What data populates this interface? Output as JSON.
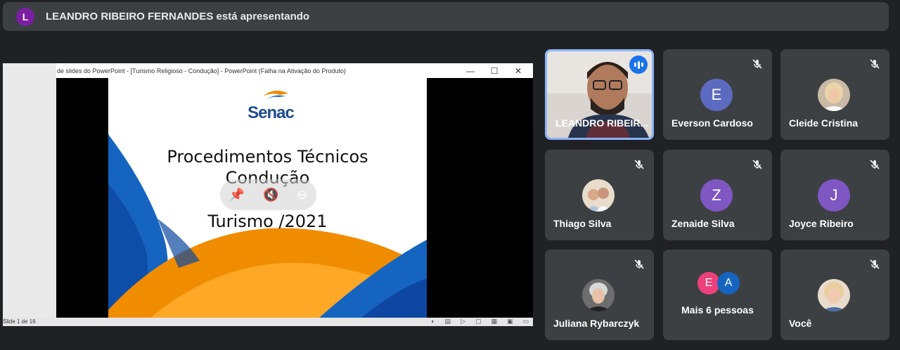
{
  "banner": {
    "avatar_letter": "L",
    "text": "LEANDRO RIBEIRO FERNANDES está apresentando",
    "avatar_color": "#7b1fa2"
  },
  "presentation": {
    "window_title": "de slides do PowerPoint - [Turismo Religioso - Condução] - PowerPoint (Falha na Ativação do Produto)",
    "window_controls": [
      "—",
      "☐",
      "✕"
    ],
    "status_text": "Slide 1 de 16",
    "slide": {
      "logo_text": "Senac",
      "title_line1": "Procedimentos Técnicos",
      "title_line2": "Condução",
      "title_line3": "Turismo /2021"
    }
  },
  "participants": [
    {
      "name": "LEANDRO RIBEIR...",
      "kind": "video",
      "speaking": true
    },
    {
      "name": "Everson Cardoso",
      "kind": "letter",
      "letter": "E",
      "color": "#5c6bc0",
      "muted": true
    },
    {
      "name": "Cleide Cristina",
      "kind": "photo",
      "muted": true
    },
    {
      "name": "Thiago Silva",
      "kind": "photo",
      "muted": true
    },
    {
      "name": "Zenaide Silva",
      "kind": "letter",
      "letter": "Z",
      "color": "#7e57c2",
      "muted": true
    },
    {
      "name": "Joyce Ribeiro",
      "kind": "letter",
      "letter": "J",
      "color": "#7e57c2",
      "muted": true
    },
    {
      "name": "Juliana Rybarczyk",
      "kind": "photo",
      "muted": true
    },
    {
      "name": "Mais 6 pessoas",
      "kind": "more",
      "letters": [
        "E",
        "A"
      ],
      "colors": [
        "#ec407a",
        "#1565c0"
      ]
    },
    {
      "name": "Você",
      "kind": "photo",
      "muted": true
    }
  ],
  "colors": {
    "background": "#202124",
    "tile": "#3c4043",
    "active_border": "#8ab4f8",
    "speaking": "#1a73e8"
  }
}
